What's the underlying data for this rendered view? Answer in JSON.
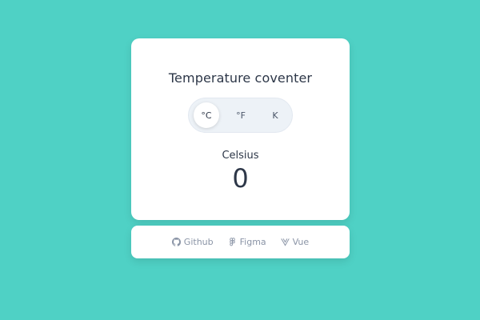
{
  "title": "Temperature coventer",
  "units": [
    {
      "label": "°C",
      "active": true
    },
    {
      "label": "°F",
      "active": false
    },
    {
      "label": "K",
      "active": false
    }
  ],
  "result": {
    "unit_name": "Celsius",
    "value": "0"
  },
  "footer": {
    "links": [
      {
        "label": "Github",
        "icon": "github-icon"
      },
      {
        "label": "Figma",
        "icon": "figma-icon"
      },
      {
        "label": "Vue",
        "icon": "vue-icon"
      }
    ]
  },
  "colors": {
    "background": "#4fd1c5",
    "card": "#ffffff",
    "text": "#2d3748",
    "muted": "#8a94a6"
  }
}
